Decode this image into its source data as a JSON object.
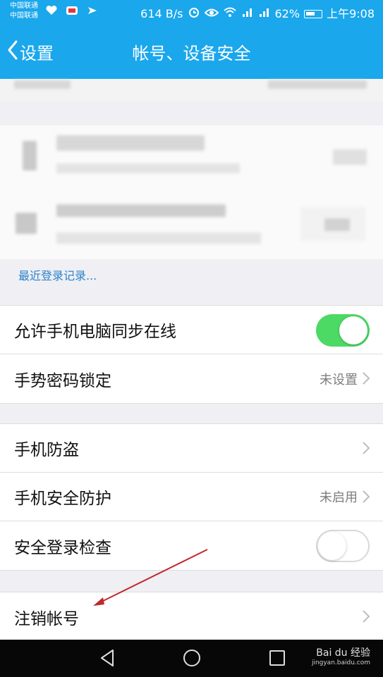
{
  "status_bar": {
    "carrier_1": "中国联通",
    "carrier_2": "中国联通",
    "speed": "614 B/s",
    "battery": "62%",
    "time": "上午9:08"
  },
  "nav": {
    "back_label": "设置",
    "title": "帐号、设备安全"
  },
  "recent_login_link": "最近登录记录...",
  "group1": {
    "sync_online_label": "允许手机电脑同步在线",
    "sync_online_on": true,
    "gesture_lock_label": "手势密码锁定",
    "gesture_lock_value": "未设置"
  },
  "group2": {
    "anti_theft_label": "手机防盗",
    "security_protect_label": "手机安全防护",
    "security_protect_value": "未启用",
    "login_check_label": "安全登录检查",
    "login_check_on": false
  },
  "group3": {
    "cancel_account_label": "注销帐号"
  },
  "watermark": {
    "brand": "Bai du 经验",
    "url": "jingyan.baidu.com"
  },
  "colors": {
    "accent": "#1aa7ec",
    "toggle_on": "#4cd964",
    "link": "#2a82c9",
    "annotation_arrow": "#c0282c"
  }
}
